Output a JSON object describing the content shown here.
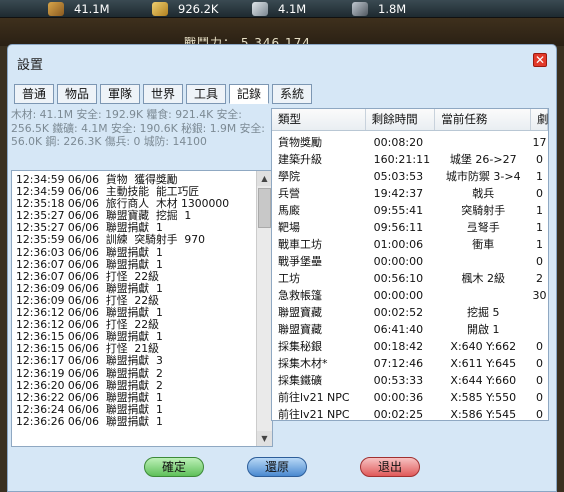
{
  "hud": {
    "resources": [
      {
        "icon": "wood-icon",
        "value": "41.1M"
      },
      {
        "icon": "grain-icon",
        "value": "926.2K"
      },
      {
        "icon": "iron-icon",
        "value": "4.1M"
      },
      {
        "icon": "silver-icon",
        "value": "1.8M"
      }
    ],
    "power_text": "戰鬥力： 5,346,174"
  },
  "dialog": {
    "title": "設置",
    "close_icon": "close-icon",
    "tabs": [
      "普通",
      "物品",
      "軍隊",
      "世界",
      "工具",
      "記錄",
      "系統"
    ],
    "active_tab": "記錄",
    "info_text": "木材: 41.1M 安全: 192.9K  糧食: 921.4K 安全: 256.5K  鐵礦: 4.1M 安全: 190.6K  秘銀: 1.9M 安全: 56.0K  鋼: 226.3K  傷兵: 0   城防: 14100",
    "log_lines": [
      "12:34:59 06/06  貨物  獲得獎勵",
      "12:34:59 06/06  主動技能  能工巧匠",
      "12:35:18 06/06  旅行商人  木材 1300000",
      "12:35:27 06/06  聯盟寶藏  挖掘  1",
      "12:35:27 06/06  聯盟捐獻  1",
      "12:35:59 06/06  訓練  突騎射手  970",
      "12:36:03 06/06  聯盟捐獻  1",
      "12:36:07 06/06  聯盟捐獻  1",
      "12:36:07 06/06  打怪  22級",
      "12:36:09 06/06  聯盟捐獻  1",
      "12:36:09 06/06  打怪  22級",
      "12:36:12 06/06  聯盟捐獻  1",
      "12:36:12 06/06  打怪  22級",
      "12:36:15 06/06  聯盟捐獻  1",
      "12:36:15 06/06  打怪  21級",
      "12:36:17 06/06  聯盟捐獻  3",
      "12:36:19 06/06  聯盟捐獻  2",
      "12:36:20 06/06  聯盟捐獻  2",
      "12:36:22 06/06  聯盟捐獻  1",
      "12:36:24 06/06  聯盟捐獻  1",
      "12:36:26 06/06  聯盟捐獻  1"
    ],
    "table": {
      "headers": [
        "類型",
        "剩餘時間",
        "當前任務",
        "劇"
      ],
      "rows": [
        [
          "貨物獎勵",
          "00:08:20",
          "",
          "17"
        ],
        [
          "建築升級",
          "160:21:11",
          "城堡 26->27",
          "0"
        ],
        [
          "學院",
          "05:03:53",
          "城市防禦 3->4",
          "1"
        ],
        [
          "兵營",
          "19:42:37",
          "戟兵",
          "0"
        ],
        [
          "馬廄",
          "09:55:41",
          "突騎射手",
          "1"
        ],
        [
          "靶場",
          "09:56:11",
          "弖弩手",
          "1"
        ],
        [
          "戰車工坊",
          "01:00:06",
          "衝車",
          "1"
        ],
        [
          "戰爭堡壘",
          "00:00:00",
          "",
          "0"
        ],
        [
          "工坊",
          "00:56:10",
          "楓木 2級",
          "2"
        ],
        [
          "急救帳篷",
          "00:00:00",
          "",
          "30"
        ],
        [
          "聯盟寶藏",
          "00:02:52",
          "挖掘 5",
          ""
        ],
        [
          "聯盟寶藏",
          "06:41:40",
          "開啟 1",
          ""
        ],
        [
          "採集秘銀",
          "00:18:42",
          "X:640 Y:662",
          "0"
        ],
        [
          "採集木材*",
          "07:12:46",
          "X:611 Y:645",
          "0"
        ],
        [
          "採集鐵礦",
          "00:53:33",
          "X:644 Y:660",
          "0"
        ],
        [
          "前往lv21 NPC",
          "00:00:36",
          "X:585 Y:550",
          "0"
        ],
        [
          "前往lv21 NPC",
          "00:02:25",
          "X:586 Y:545",
          "0"
        ]
      ]
    },
    "buttons": {
      "ok": "確定",
      "reset": "還原",
      "exit": "退出"
    }
  }
}
